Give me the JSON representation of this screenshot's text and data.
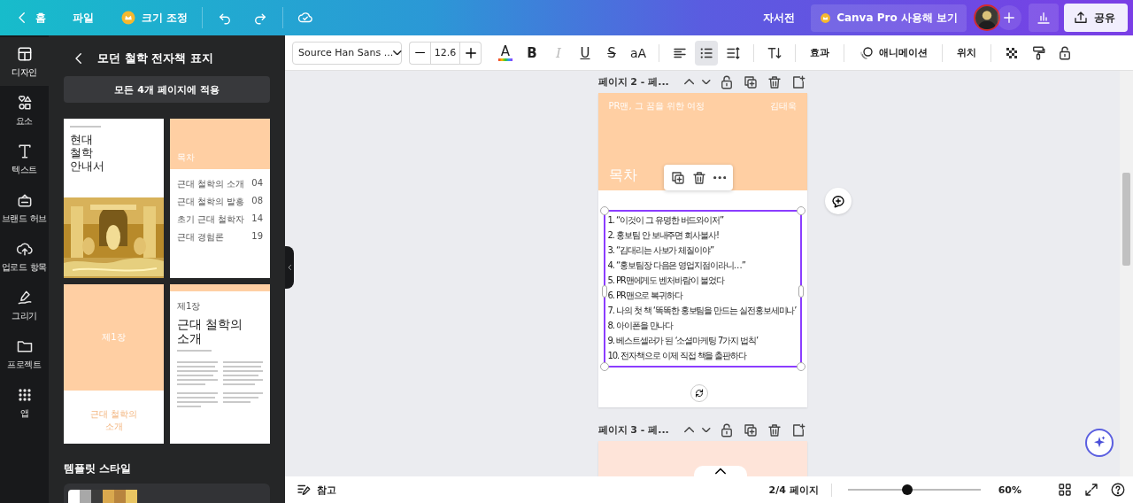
{
  "topbar": {
    "nav": [
      {
        "kind": "back",
        "label": "홈"
      },
      {
        "kind": "plain",
        "label": "파일"
      },
      {
        "kind": "crown",
        "label": "크기 조정"
      }
    ],
    "design_title": "자서전",
    "pro_button": "Canva Pro 사용해 보기",
    "share_button": "공유"
  },
  "rail": [
    {
      "kind": "layout",
      "label": "디자인",
      "selected": true
    },
    {
      "kind": "shapes",
      "label": "요소",
      "selected": false
    },
    {
      "kind": "text",
      "label": "텍스트",
      "selected": false
    },
    {
      "kind": "brand",
      "label": "브랜드 허브",
      "selected": false
    },
    {
      "kind": "upload",
      "label": "업로드 항목",
      "selected": false
    },
    {
      "kind": "draw",
      "label": "그리기",
      "selected": false
    },
    {
      "kind": "folder",
      "label": "프로젝트",
      "selected": false
    },
    {
      "kind": "apps",
      "label": "앱",
      "selected": false
    }
  ],
  "panel": {
    "title": "모던 철학 전자책 표지",
    "apply_button": "모든 4개 페이지에 적용",
    "thumbnails": [
      {
        "kind": "cover",
        "title": "현대 철학 안내서"
      },
      {
        "kind": "toc",
        "title": "목차",
        "entries": [
          {
            "text": "근대 철학의 소개",
            "page": "04"
          },
          {
            "text": "근대 철학의 발흥",
            "page": "08"
          },
          {
            "text": "초기 근대 철학자",
            "page": "14"
          },
          {
            "text": "근대 경험론",
            "page": "19"
          }
        ]
      },
      {
        "kind": "chapter",
        "label": "제1장",
        "title": "근대 철학의 소개"
      },
      {
        "kind": "article",
        "label": "제1장",
        "title": "근대 철학의 소개"
      }
    ],
    "styles_title": "템플릿 스타일",
    "palette": [
      {
        "color": "#ffffff"
      },
      {
        "color": "#a8a8a8"
      },
      {
        "color": "#3c3c3c"
      },
      {
        "color": "#d9a84e"
      },
      {
        "color": "#b8843e"
      },
      {
        "color": "#e8c462"
      }
    ]
  },
  "toolbar": {
    "font": "Source Han Sans ...",
    "size": "12.6",
    "format": [
      {
        "kind": "color",
        "label": "A",
        "disabled": false
      },
      {
        "kind": "bold",
        "label": "B",
        "disabled": false
      },
      {
        "kind": "italic",
        "label": "I",
        "disabled": true
      },
      {
        "kind": "underline",
        "label": "U",
        "disabled": false
      },
      {
        "kind": "strike",
        "label": "S",
        "disabled": false
      },
      {
        "kind": "case",
        "label": "aA",
        "disabled": false
      }
    ],
    "paragraph": [
      {
        "kind": "align",
        "selected": false
      },
      {
        "kind": "list",
        "selected": true
      },
      {
        "kind": "spacing",
        "selected": false
      }
    ],
    "effects": "효과",
    "animate": "애니메이션",
    "position": "위치"
  },
  "pages": [
    {
      "kind": "toc",
      "label": "페이지 2 - 페...",
      "header_left": "PR맨, 그 꿈을 위한 여정",
      "header_right": "김태욱",
      "title": "목차",
      "items": [
        "1. “이것이 그 유명한 버드와이저”",
        "2. 홍보팀 안 보내주면 회사불사!",
        "3. “김대리는 사보가 체질이야”",
        "4. “홍보팀장 다음은 영업지점이라니…”",
        "5. PR맨에게도 벤처바람이 불었다",
        "6. PR맨으로 복귀하다",
        "7. 나의 첫 책 ‘똑똑한 홍보팀을 만드는 실전홍보세미나’",
        "8. 아이폰을 만나다",
        "9. 베스트셀러가 된 ‘소셜마케팅 7가지 법칙’",
        "10. 전자책으로 이제 직접 책을 출판하다"
      ]
    },
    {
      "kind": "blank",
      "label": "페이지 3 - 페..."
    }
  ],
  "bottom": {
    "notes": "참고",
    "page_count": "2/4 페이지",
    "zoom": {
      "level": 0.45
    },
    "zoom_text": "60%"
  }
}
